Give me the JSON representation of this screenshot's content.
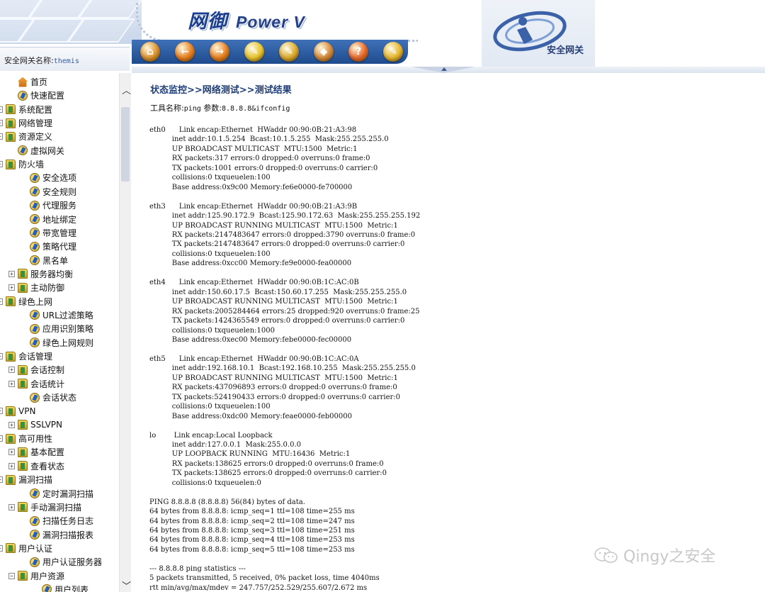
{
  "header": {
    "brand_title": "网御",
    "brand_sub": "Power V",
    "gateway_label": "安全网关名称:",
    "gateway_name": "themis",
    "logo_text": "安全网关",
    "toolbar": [
      {
        "icon": "home-icon",
        "glyph": "⌂",
        "color": "#d9902c"
      },
      {
        "icon": "back-icon",
        "glyph": "←",
        "color": "#e67e1e"
      },
      {
        "icon": "forward-icon",
        "glyph": "→",
        "color": "#e67e1e"
      },
      {
        "icon": "pencil-icon",
        "glyph": "✎",
        "color": "#e6c42c"
      },
      {
        "icon": "edit-icon",
        "glyph": "✎",
        "color": "#d9a92c"
      },
      {
        "icon": "diamond-icon",
        "glyph": "◆",
        "color": "#d48a3a"
      },
      {
        "icon": "help-icon",
        "glyph": "?",
        "color": "#e6662a"
      },
      {
        "icon": "tools-icon",
        "glyph": "✎",
        "color": "#e6b62c"
      }
    ]
  },
  "sidebar": {
    "items": [
      {
        "label": "首页",
        "level": 1,
        "icon": "home",
        "expander": ""
      },
      {
        "label": "快速配置",
        "level": 1,
        "icon": "page",
        "expander": ""
      },
      {
        "label": "系统配置",
        "level": 0,
        "icon": "folder",
        "expander": "+"
      },
      {
        "label": "网络管理",
        "level": 0,
        "icon": "folder",
        "expander": "+"
      },
      {
        "label": "资源定义",
        "level": 0,
        "icon": "folder",
        "expander": "+"
      },
      {
        "label": "虚拟网关",
        "level": 1,
        "icon": "page",
        "expander": ""
      },
      {
        "label": "防火墙",
        "level": 0,
        "icon": "folder",
        "expander": "−"
      },
      {
        "label": "安全选项",
        "level": 2,
        "icon": "page",
        "expander": ""
      },
      {
        "label": "安全规则",
        "level": 2,
        "icon": "page",
        "expander": ""
      },
      {
        "label": "代理服务",
        "level": 2,
        "icon": "page",
        "expander": ""
      },
      {
        "label": "地址绑定",
        "level": 2,
        "icon": "page",
        "expander": ""
      },
      {
        "label": "带宽管理",
        "level": 2,
        "icon": "page",
        "expander": ""
      },
      {
        "label": "策略代理",
        "level": 2,
        "icon": "page",
        "expander": ""
      },
      {
        "label": "黑名单",
        "level": 2,
        "icon": "page",
        "expander": ""
      },
      {
        "label": "服务器均衡",
        "level": 1,
        "icon": "folder",
        "expander": "+"
      },
      {
        "label": "主动防御",
        "level": 1,
        "icon": "folder",
        "expander": "+"
      },
      {
        "label": "绿色上网",
        "level": 0,
        "icon": "folder",
        "expander": "−"
      },
      {
        "label": "URL过滤策略",
        "level": 2,
        "icon": "page",
        "expander": ""
      },
      {
        "label": "应用识别策略",
        "level": 2,
        "icon": "page",
        "expander": ""
      },
      {
        "label": "绿色上网规则",
        "level": 2,
        "icon": "page",
        "expander": ""
      },
      {
        "label": "会话管理",
        "level": 0,
        "icon": "folder",
        "expander": "−"
      },
      {
        "label": "会话控制",
        "level": 1,
        "icon": "folder",
        "expander": "+"
      },
      {
        "label": "会话统计",
        "level": 1,
        "icon": "folder",
        "expander": "+"
      },
      {
        "label": "会话状态",
        "level": 2,
        "icon": "page",
        "expander": ""
      },
      {
        "label": "VPN",
        "level": 0,
        "icon": "folder",
        "expander": "−"
      },
      {
        "label": "SSLVPN",
        "level": 1,
        "icon": "folder",
        "expander": "+"
      },
      {
        "label": "高可用性",
        "level": 0,
        "icon": "folder",
        "expander": "−"
      },
      {
        "label": "基本配置",
        "level": 1,
        "icon": "folder",
        "expander": "+"
      },
      {
        "label": "查看状态",
        "level": 1,
        "icon": "folder",
        "expander": "+"
      },
      {
        "label": "漏洞扫描",
        "level": 0,
        "icon": "folder",
        "expander": "−"
      },
      {
        "label": "定时漏洞扫描",
        "level": 2,
        "icon": "page",
        "expander": ""
      },
      {
        "label": "手动漏洞扫描",
        "level": 1,
        "icon": "folder",
        "expander": "+"
      },
      {
        "label": "扫描任务日志",
        "level": 2,
        "icon": "page",
        "expander": ""
      },
      {
        "label": "漏洞扫描报表",
        "level": 2,
        "icon": "page",
        "expander": ""
      },
      {
        "label": "用户认证",
        "level": 0,
        "icon": "folder",
        "expander": "−"
      },
      {
        "label": "用户认证服务器",
        "level": 2,
        "icon": "page",
        "expander": ""
      },
      {
        "label": "用户资源",
        "level": 1,
        "icon": "folder",
        "expander": "−"
      },
      {
        "label": "用户列表",
        "level": 3,
        "icon": "page",
        "expander": ""
      }
    ]
  },
  "content": {
    "breadcrumb": "状态监控>>网络测试>>测试结果",
    "tool_label": "工具名称:",
    "tool_name": "ping",
    "param_label": " 参数:",
    "param_value": "8.8.8.8&ifconfig",
    "output": "eth0      Link encap:Ethernet  HWaddr 00:90:0B:21:A3:98\n          inet addr:10.1.5.254  Bcast:10.1.5.255  Mask:255.255.255.0\n          UP BROADCAST MULTICAST  MTU:1500  Metric:1\n          RX packets:317 errors:0 dropped:0 overruns:0 frame:0\n          TX packets:1001 errors:0 dropped:0 overruns:0 carrier:0\n          collisions:0 txqueuelen:100\n          Base address:0x9c00 Memory:fe6e0000-fe700000\n\neth3      Link encap:Ethernet  HWaddr 00:90:0B:21:A3:9B\n          inet addr:125.90.172.9  Bcast:125.90.172.63  Mask:255.255.255.192\n          UP BROADCAST RUNNING MULTICAST  MTU:1500  Metric:1\n          RX packets:2147483647 errors:0 dropped:3790 overruns:0 frame:0\n          TX packets:2147483647 errors:0 dropped:0 overruns:0 carrier:0\n          collisions:0 txqueuelen:100\n          Base address:0xcc00 Memory:fe9e0000-fea00000\n\neth4      Link encap:Ethernet  HWaddr 00:90:0B:1C:AC:0B\n          inet addr:150.60.17.5  Bcast:150.60.17.255  Mask:255.255.255.0\n          UP BROADCAST RUNNING MULTICAST  MTU:1500  Metric:1\n          RX packets:2005284464 errors:25 dropped:920 overruns:0 frame:25\n          TX packets:1424365549 errors:0 dropped:0 overruns:0 carrier:0\n          collisions:0 txqueuelen:1000\n          Base address:0xec00 Memory:febe0000-fec00000\n\neth5      Link encap:Ethernet  HWaddr 00:90:0B:1C:AC:0A\n          inet addr:192.168.10.1  Bcast:192.168.10.255  Mask:255.255.255.0\n          UP BROADCAST RUNNING MULTICAST  MTU:1500  Metric:1\n          RX packets:437096893 errors:0 dropped:0 overruns:0 frame:0\n          TX packets:524190433 errors:0 dropped:0 overruns:0 carrier:0\n          collisions:0 txqueuelen:100\n          Base address:0xdc00 Memory:feae0000-feb00000\n\nlo        Link encap:Local Loopback\n          inet addr:127.0.0.1  Mask:255.0.0.0\n          UP LOOPBACK RUNNING  MTU:16436  Metric:1\n          RX packets:138625 errors:0 dropped:0 overruns:0 frame:0\n          TX packets:138625 errors:0 dropped:0 overruns:0 carrier:0\n          collisions:0 txqueuelen:0\n\nPING 8.8.8.8 (8.8.8.8) 56(84) bytes of data.\n64 bytes from 8.8.8.8: icmp_seq=1 ttl=108 time=255 ms\n64 bytes from 8.8.8.8: icmp_seq=2 ttl=108 time=247 ms\n64 bytes from 8.8.8.8: icmp_seq=3 ttl=108 time=251 ms\n64 bytes from 8.8.8.8: icmp_seq=4 ttl=108 time=253 ms\n64 bytes from 8.8.8.8: icmp_seq=5 ttl=108 time=253 ms\n\n--- 8.8.8.8 ping statistics ---\n5 packets transmitted, 5 received, 0% packet loss, time 4040ms\nrtt min/avg/max/mdev = 247.757/252.529/255.607/2.672 ms"
  },
  "watermark": "Qingy之安全"
}
